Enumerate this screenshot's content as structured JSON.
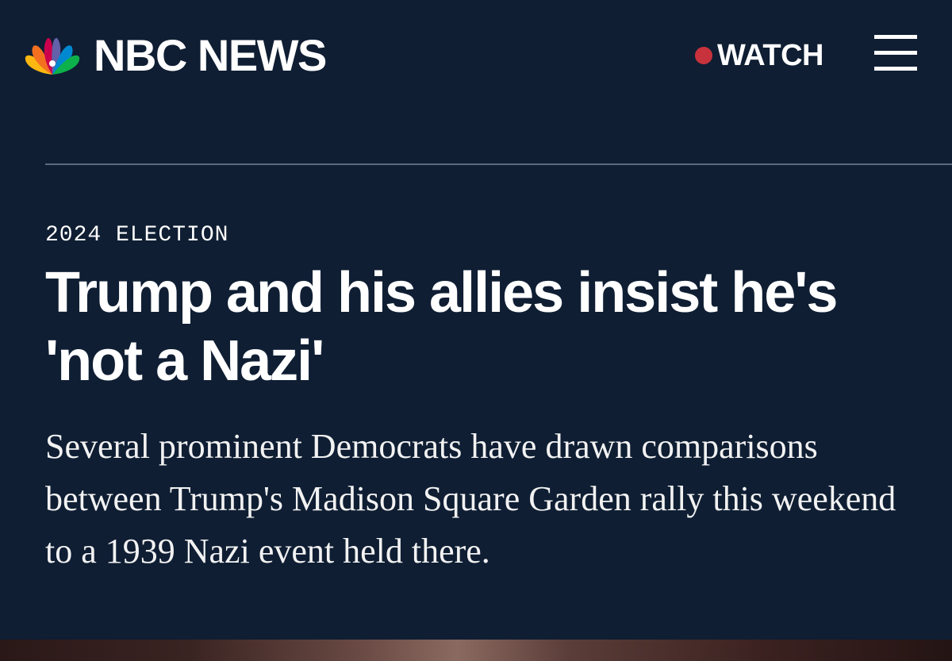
{
  "header": {
    "brand": "NBC NEWS",
    "logo_icon": "nbc-peacock-icon",
    "watch_label": "WATCH",
    "live_dot_color": "#c8323c",
    "menu_icon": "hamburger-menu-icon"
  },
  "article": {
    "section": "2024 ELECTION",
    "headline": "Trump and his allies insist he's 'not a Nazi'",
    "dek": "Several prominent Democrats have drawn comparisons between Trump's Madison Square Garden rally this weekend to a 1939 Nazi event held there."
  },
  "colors": {
    "background": "#0f1e33",
    "text": "#ffffff",
    "divider": "#5d6a80"
  }
}
